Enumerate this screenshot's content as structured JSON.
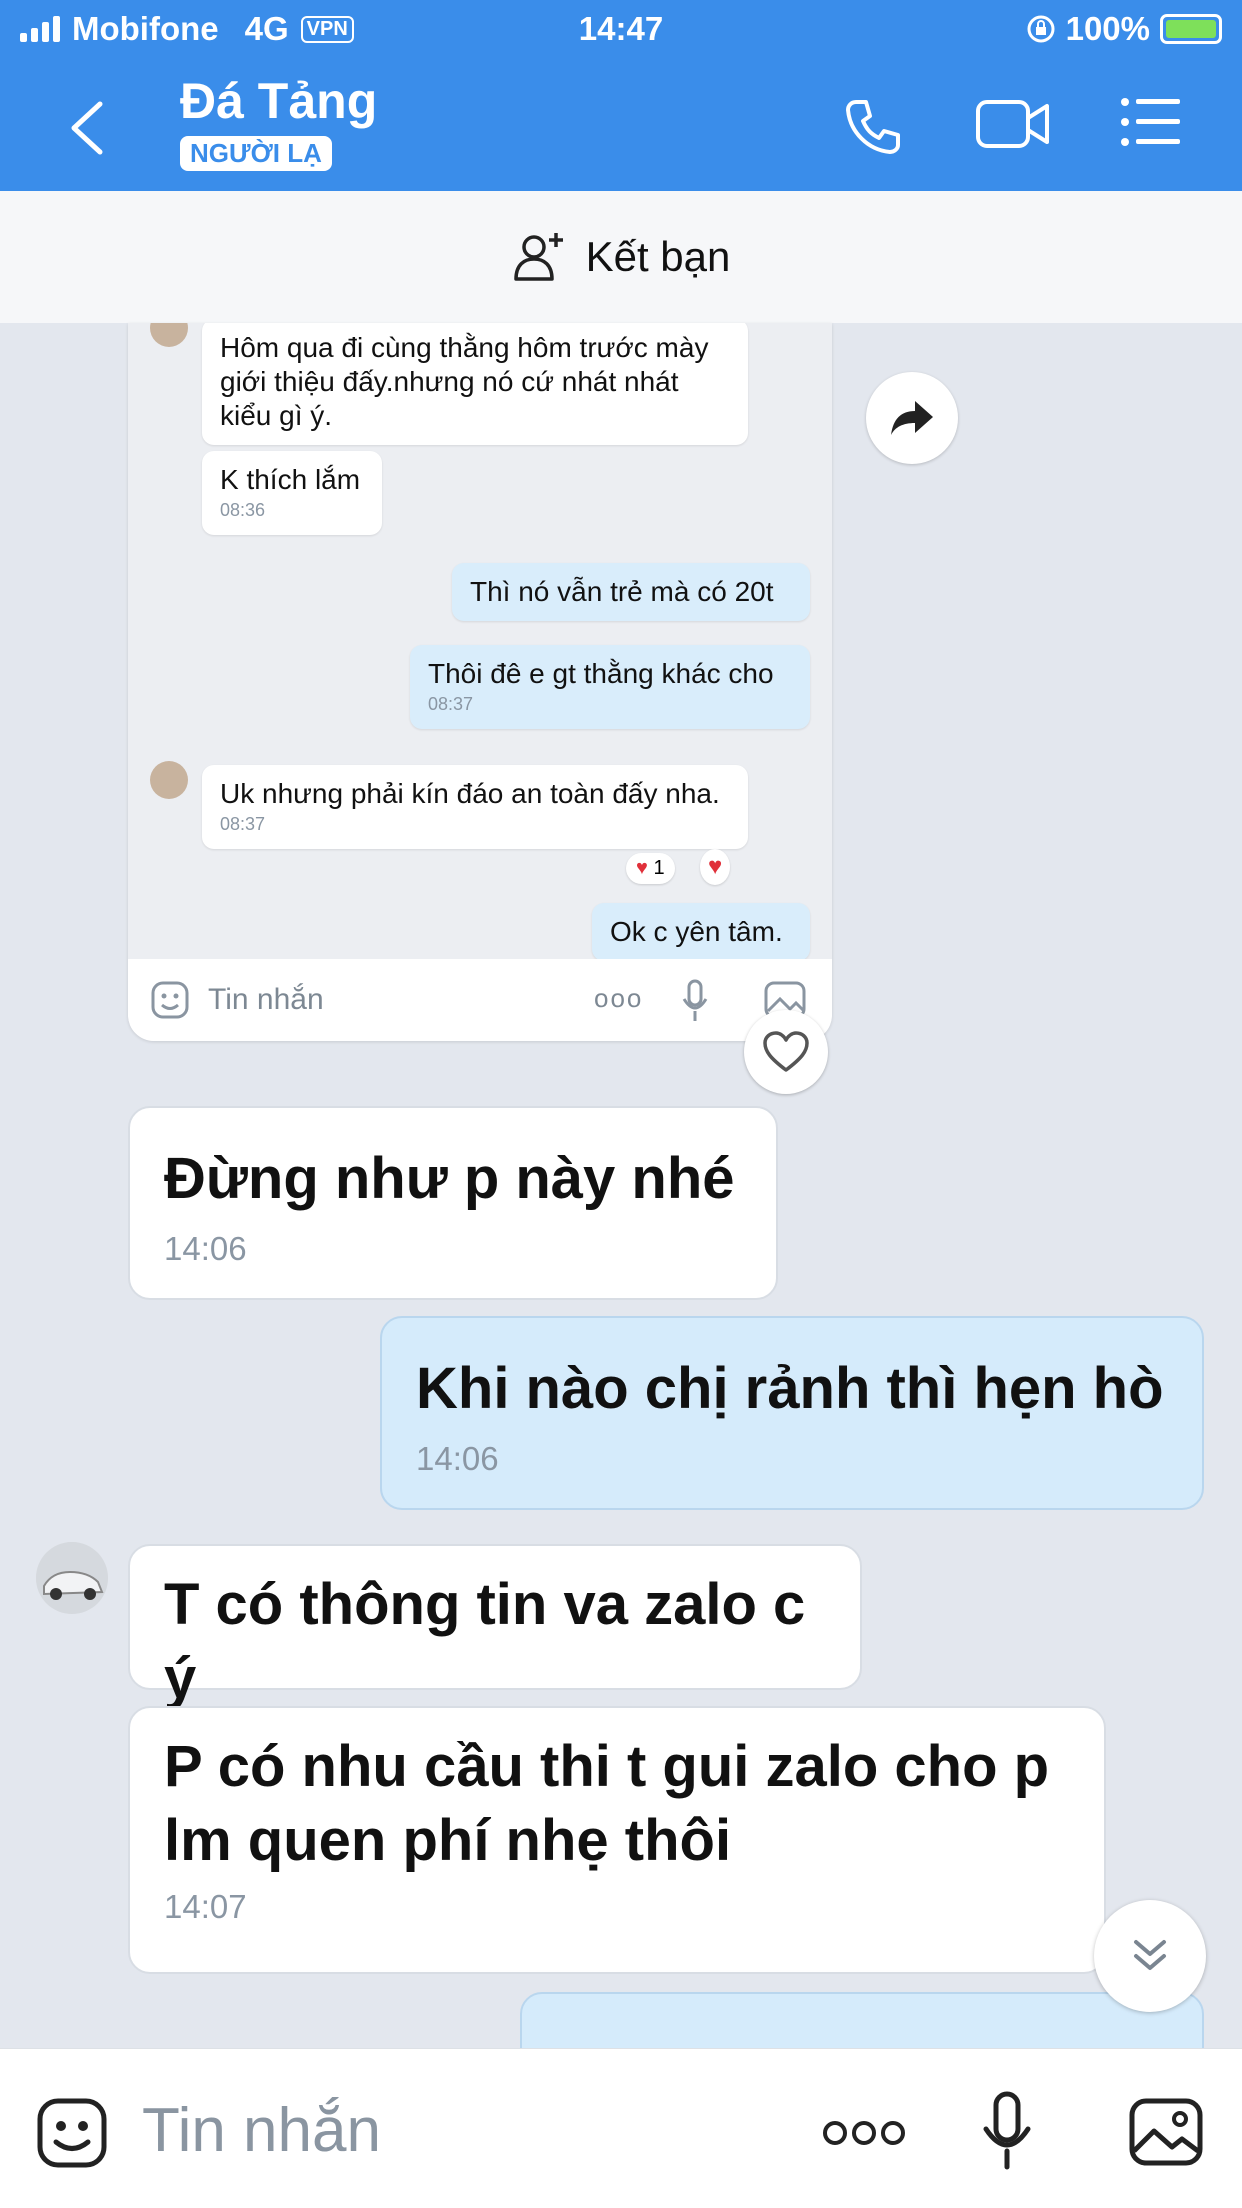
{
  "status_bar": {
    "carrier": "Mobifone",
    "network": "4G",
    "vpn": "VPN",
    "time": "14:47",
    "battery": "100%"
  },
  "header": {
    "contact_name": "Đá Tảng",
    "badge": "NGƯỜI LẠ",
    "back_icon": "chevron-left-icon",
    "call_icon": "phone-icon",
    "video_icon": "video-camera-icon",
    "menu_icon": "list-menu-icon",
    "color": "#3a8dea"
  },
  "add_friend": {
    "label": "Kết bạn",
    "icon": "add-user-icon"
  },
  "embedded_screenshot": {
    "messages": [
      {
        "text": "Hôm qua đi cùng thằng hôm trước mày giới thiệu đấy.nhưng nó cứ nhát nhát kiểu gì ý.",
        "time": ""
      },
      {
        "text": "K thích lắm",
        "time": "08:36"
      },
      {
        "text": "Thì nó vẫn trẻ mà có 20t",
        "time": ""
      },
      {
        "text": "Thôi đê e gt thằng khác cho",
        "time": "08:37"
      },
      {
        "text": "Uk nhưng phải kín đáo an toàn đấy nha.",
        "time": "08:37"
      },
      {
        "text": "Ok c yên tâm.",
        "time": ""
      }
    ],
    "reaction_count": "1",
    "input_placeholder": "Tin nhắn"
  },
  "messages": [
    {
      "text": "Đừng như p này nhé",
      "time": "14:06",
      "sender": "other"
    },
    {
      "text": "Khi nào chị rảnh thì hẹn hò",
      "time": "14:06",
      "sender": "me"
    },
    {
      "text": "T có thông tin va zalo c ý",
      "time": "",
      "sender": "other"
    },
    {
      "text": "P có nhu cầu thi t gui zalo cho p lm quen phí nhẹ thôi",
      "time": "14:07",
      "sender": "other"
    }
  ],
  "composer": {
    "placeholder": "Tin nhắn",
    "emoji_icon": "emoji-icon",
    "more_icon": "more-dots-icon",
    "mic_icon": "microphone-icon",
    "image_icon": "image-icon"
  }
}
